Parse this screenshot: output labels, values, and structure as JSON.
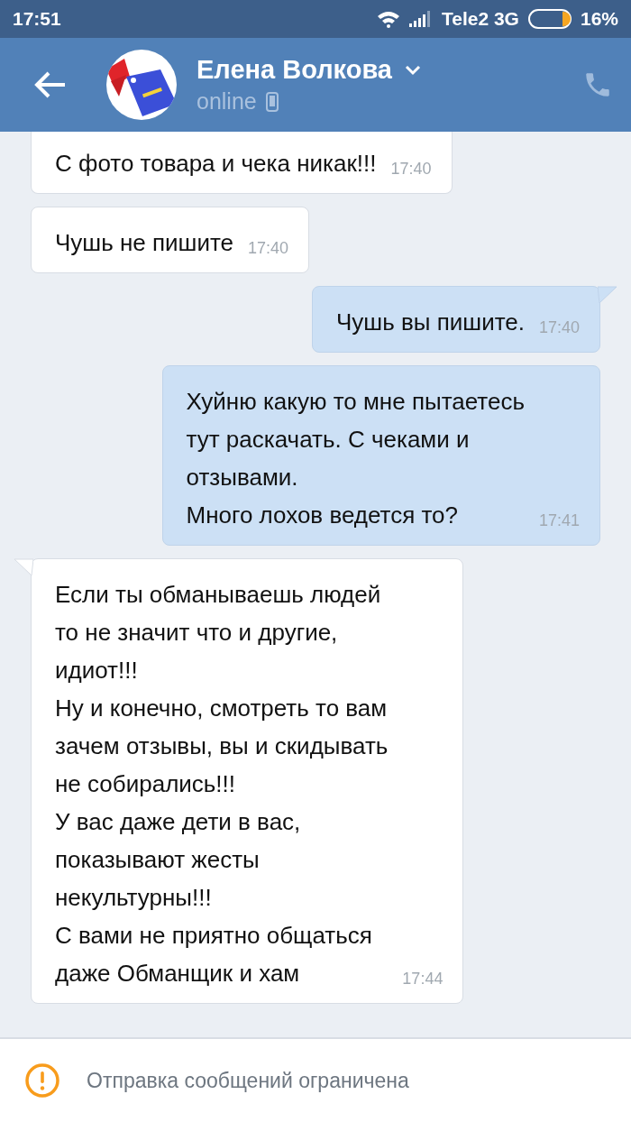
{
  "status_bar": {
    "time": "17:51",
    "carrier": "Tele2 3G",
    "battery": "16%"
  },
  "header": {
    "name": "Елена Волкова",
    "status": "online"
  },
  "messages": [
    {
      "kind": "incoming",
      "cut_top": true,
      "tail": false,
      "text": "С фото товара и чека никак!!!",
      "time": "17:40"
    },
    {
      "kind": "incoming",
      "cut_top": false,
      "tail": false,
      "text": "Чушь не пишите",
      "time": "17:40"
    },
    {
      "kind": "outgoing",
      "cut_top": false,
      "tail": true,
      "text": "Чушь вы пишите.",
      "time": "17:40"
    },
    {
      "kind": "outgoing",
      "cut_top": false,
      "tail": false,
      "text": "Хуйню какую то мне пытаетесь\nтут раскачать. С чеками и\nотзывами.\nМного лохов ведется то?",
      "time": "17:41"
    },
    {
      "kind": "incoming",
      "cut_top": false,
      "tail": true,
      "text": "Если ты обманываешь людей\nто не значит что и другие,\nидиот!!!\nНу и конечно, смотреть то вам\nзачем отзывы, вы и скидывать\nне собирались!!!\nУ вас даже дети в вас,\nпоказывают жесты\nнекультурны!!!\n С вами не приятно общаться\nдаже Обманщик и хам",
      "time": "17:44"
    }
  ],
  "notice": {
    "text": "Отправка сообщений ограничена"
  }
}
